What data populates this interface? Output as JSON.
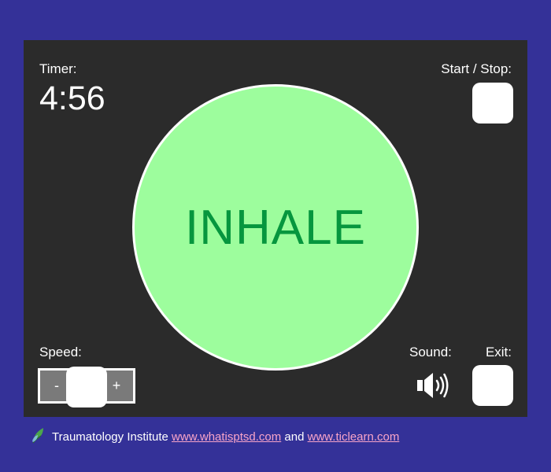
{
  "timer": {
    "label": "Timer:",
    "value": "4:56"
  },
  "start_stop": {
    "label": "Start / Stop:"
  },
  "breath": {
    "state": "INHALE"
  },
  "speed": {
    "label": "Speed:",
    "minus": "-",
    "plus": "+"
  },
  "sound": {
    "label": "Sound:",
    "icon": "speaker-volume-icon"
  },
  "exit": {
    "label": "Exit:"
  },
  "footer": {
    "org": "Traumatology Institute",
    "link1": "www.whatisptsd.com",
    "and": "and",
    "link2": "www.ticlearn.com",
    "icon": "leaf-logo-icon"
  },
  "colors": {
    "background": "#343198",
    "panel": "#2b2b2b",
    "circle_fill": "#9dfd9d",
    "breath_text": "#06963e",
    "link": "#f8a4c8"
  }
}
